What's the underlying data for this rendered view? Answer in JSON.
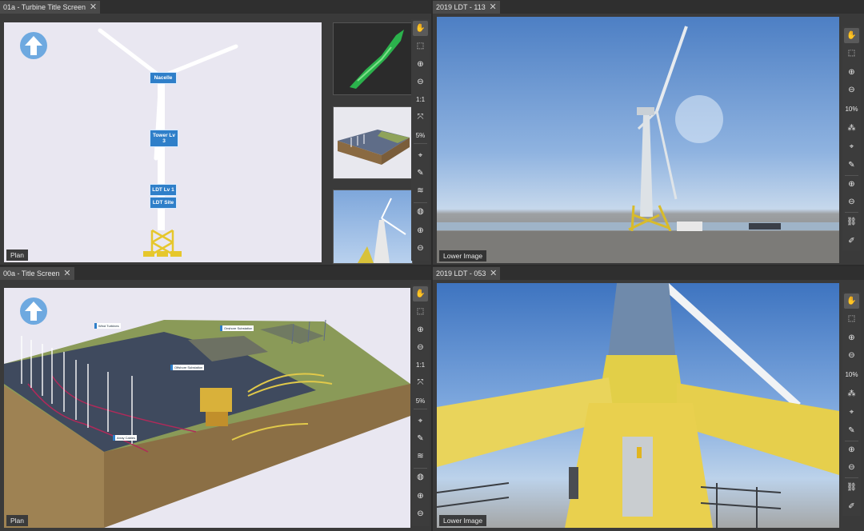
{
  "panels": {
    "top_left": {
      "tab_title": "01a - Turbine Title Screen",
      "view_label": "Plan",
      "labels": {
        "nacelle": "Nacelle",
        "tower": "Tower Lv 3",
        "ldt_lv1": "LDT Lv 1",
        "ldt_site": "LDT Site"
      },
      "zoom": "5%"
    },
    "top_right": {
      "tab_title": "2019 LDT - 113",
      "view_label": "Lower Image",
      "zoom": "10%"
    },
    "bottom_left": {
      "tab_title": "00a - Title Screen",
      "view_label": "Plan",
      "zoom": "5%",
      "labels": {
        "wind_turbines": "Wind Turbines",
        "onshore_substation": "Onshore Substation",
        "offshore_substation": "Offshore Substation",
        "array_cables": "Array Cables"
      }
    },
    "bottom_right": {
      "tab_title": "2019 LDT - 053",
      "view_label": "Lower Image",
      "zoom": "10%"
    }
  },
  "toolbar": {
    "one_to_one": "1:1",
    "close_glyph": "✕"
  },
  "icons": [
    "hand-icon",
    "select-box-icon",
    "zoom-in-icon",
    "zoom-out-icon",
    "fit-icon",
    "target-icon",
    "measure-icon",
    "layers-icon",
    "globe-icon",
    "plus-circle-icon",
    "minus-circle-icon",
    "link-icon",
    "edit-icon"
  ],
  "colors": {
    "tower_yellow": "#e6c72c",
    "label_blue": "#2f7fc9",
    "sky_blue": "#5b8fcf",
    "sea": "#3f4a5e"
  }
}
